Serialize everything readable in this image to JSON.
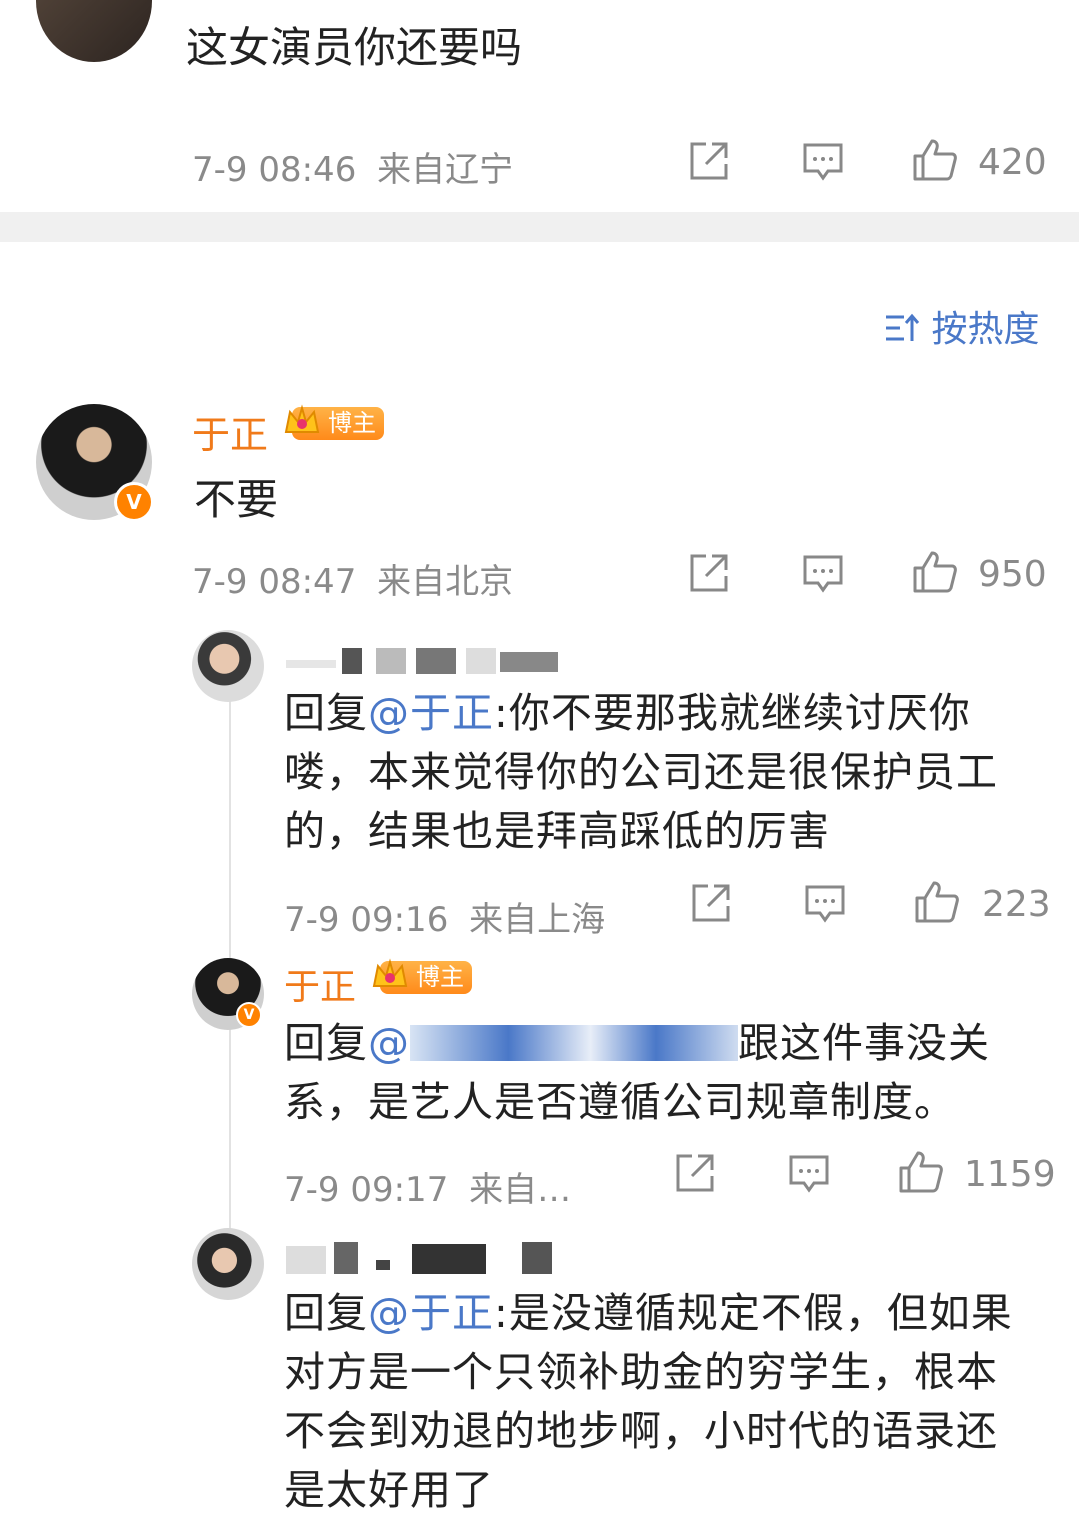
{
  "top_comment": {
    "text": "这女演员你还要吗",
    "time": "7-9 08:46",
    "location": "来自辽宁",
    "likes": "420"
  },
  "sort": {
    "label": "按热度"
  },
  "main_comment": {
    "author": "于正",
    "badge": "博主",
    "verified": "V",
    "text": "不要",
    "time": "7-9 08:47",
    "location": "来自北京",
    "likes": "950"
  },
  "replies": [
    {
      "prefix": "回复",
      "mention": "@于正",
      "text": ":你不要那我就继续讨厌你喽，本来觉得你的公司还是很保护员工的，结果也是拜高踩低的厉害",
      "time": "7-9 09:16",
      "location": "来自上海",
      "likes": "223"
    },
    {
      "author": "于正",
      "badge": "博主",
      "prefix": "回复",
      "mention": "@",
      "text": "跟这件事没关系，是艺人是否遵循公司规章制度。",
      "time": "7-9 09:17",
      "location": "来自…",
      "likes": "1159"
    },
    {
      "prefix": "回复",
      "mention": "@于正",
      "text": ":是没遵循规定不假，但如果对方是一个只领补助金的穷学生，根本不会到劝退的地步啊，小时代的语录还是太好用了"
    }
  ],
  "colors": {
    "accent_orange": "#f07a1a",
    "mention_blue": "#4a78c8",
    "meta_gray": "#8a8a8a"
  }
}
